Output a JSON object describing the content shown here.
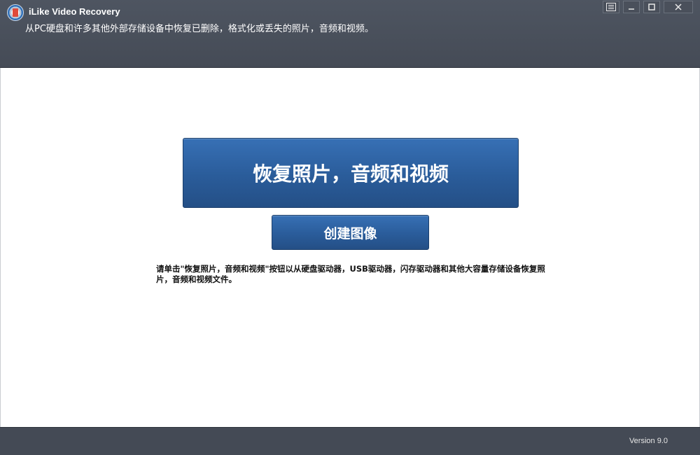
{
  "app": {
    "title": "iLike Video Recovery",
    "subtitle": "从PC硬盘和许多其他外部存储设备中恢复已删除，格式化或丢失的照片，音频和视频。",
    "logo_icon": "app-logo-icon"
  },
  "window_controls": {
    "menu_icon": "menu-list-icon",
    "minimize_label": "—",
    "maximize_icon": "maximize-icon",
    "close_label": "✕"
  },
  "main": {
    "recover_button_label": "恢复照片，音频和视频",
    "create_image_button_label": "创建图像",
    "hint_text": "请单击\"恢复照片，音频和视频\"按钮以从硬盘驱动器，USB驱动器，闪存驱动器和其他大容量存储设备恢复照片，音频和视频文件。"
  },
  "footer": {
    "version": "Version 9.0"
  },
  "colors": {
    "header_bg": "#4a505b",
    "button_blue": "#2a5c9a",
    "footer_bg": "#444a55"
  }
}
